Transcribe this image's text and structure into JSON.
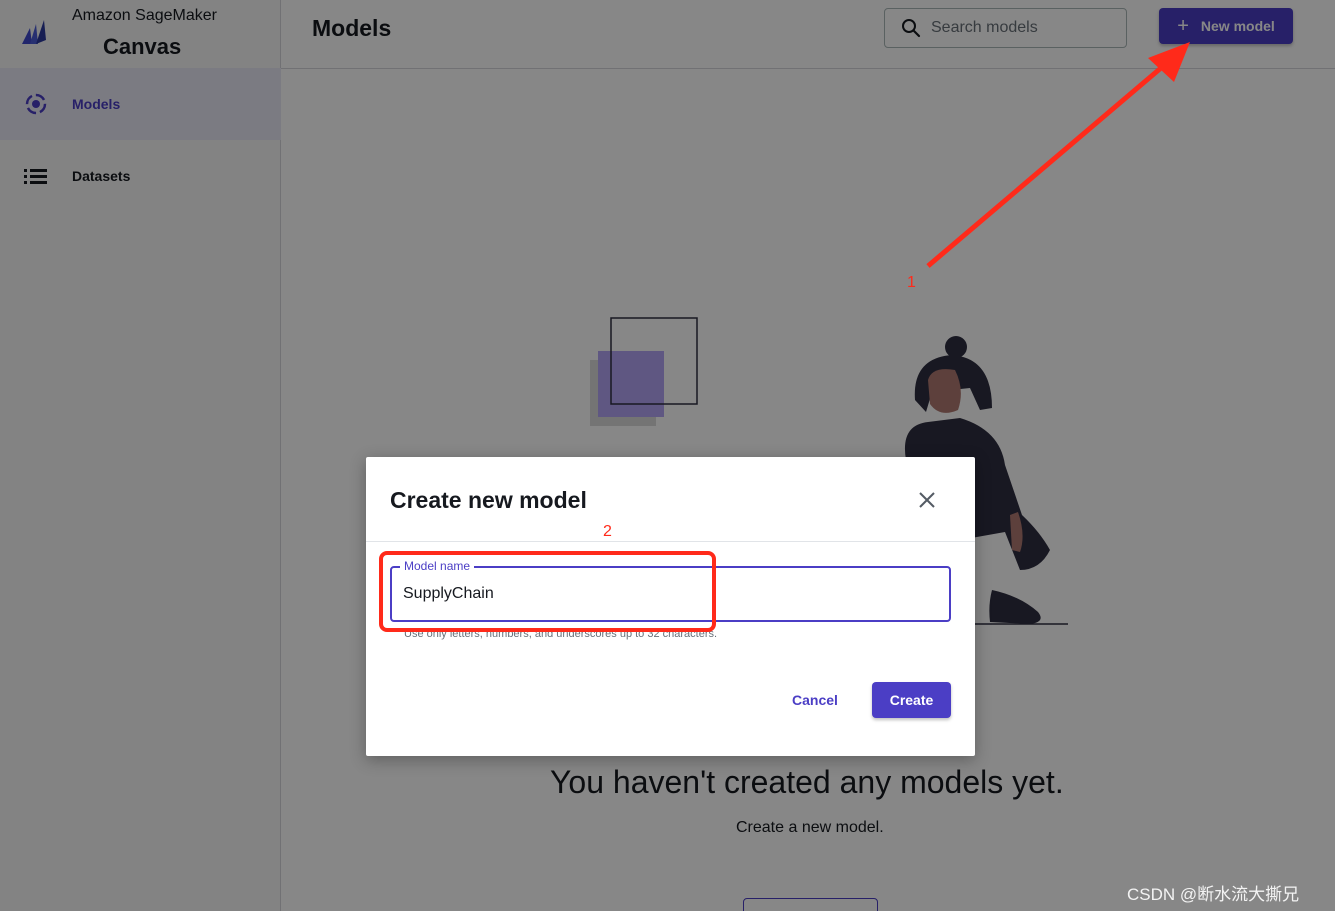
{
  "brand": {
    "subtitle": "Amazon SageMaker",
    "title": "Canvas"
  },
  "sidebar": {
    "items": [
      {
        "label": "Models",
        "icon": "models-icon",
        "active": true
      },
      {
        "label": "Datasets",
        "icon": "list-icon",
        "active": false
      }
    ]
  },
  "header": {
    "title": "Models",
    "search_placeholder": "Search models",
    "new_button_label": "New model"
  },
  "empty_state": {
    "title": "You haven't created any models yet.",
    "subtitle": "Create a new model."
  },
  "dialog": {
    "title": "Create new model",
    "field_label": "Model name",
    "field_value": "SupplyChain",
    "field_help": "Use only letters, numbers, and underscores up to 32 characters.",
    "cancel_label": "Cancel",
    "create_label": "Create"
  },
  "annotations": {
    "step1": "1",
    "step2": "2"
  },
  "watermark": "CSDN @断水流大撕兄",
  "colors": {
    "accent": "#4b3ec5",
    "annotation": "#ff2a1a",
    "overlay": "rgba(0,0,0,0.47)"
  }
}
